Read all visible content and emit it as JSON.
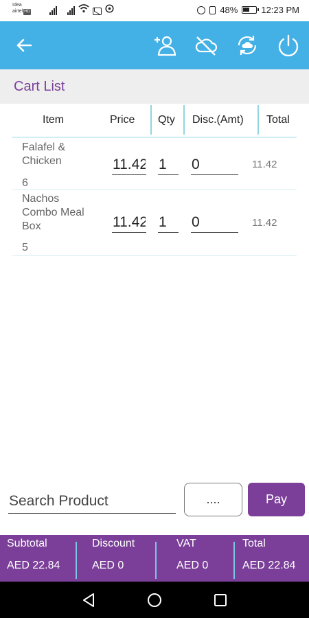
{
  "status_bar": {
    "carrier_1": "Idea",
    "carrier_2": "airtel",
    "carrier_badge": "HD",
    "battery": "48%",
    "time": "12:23 PM"
  },
  "app_bar": {
    "accent_color": "#43b0e6",
    "icons": [
      "back-arrow-icon",
      "add-customer-icon",
      "cloud-off-icon",
      "sync-icon",
      "power-icon"
    ]
  },
  "page": {
    "title": "Cart List",
    "brand_color": "#7b3f99"
  },
  "table": {
    "columns": [
      "Item",
      "Price",
      "Qty",
      "Disc.(Amt)",
      "Total"
    ],
    "rows": [
      {
        "name_line1": "Falafel &",
        "name_line2": "Chicken",
        "name_line3": "",
        "code": "6",
        "price": "11.42",
        "qty": "1",
        "discount": "0",
        "total": "11.42"
      },
      {
        "name_line1": "Nachos",
        "name_line2": "Combo Meal",
        "name_line3": "Box",
        "code": "5",
        "price": "11.42",
        "qty": "1",
        "discount": "0",
        "total": "11.42"
      }
    ]
  },
  "controls": {
    "search_placeholder": "Search Product",
    "more_label": "....",
    "pay_label": "Pay"
  },
  "summary": {
    "subtotal_label": "Subtotal",
    "subtotal_value": "AED 22.84",
    "discount_label": "Discount",
    "discount_value": "AED 0",
    "vat_label": "VAT",
    "vat_value": "AED 0",
    "total_label": "Total",
    "total_value": "AED 22.84"
  },
  "nav_bar": {
    "icons": [
      "nav-back-icon",
      "nav-home-icon",
      "nav-recents-icon"
    ]
  }
}
